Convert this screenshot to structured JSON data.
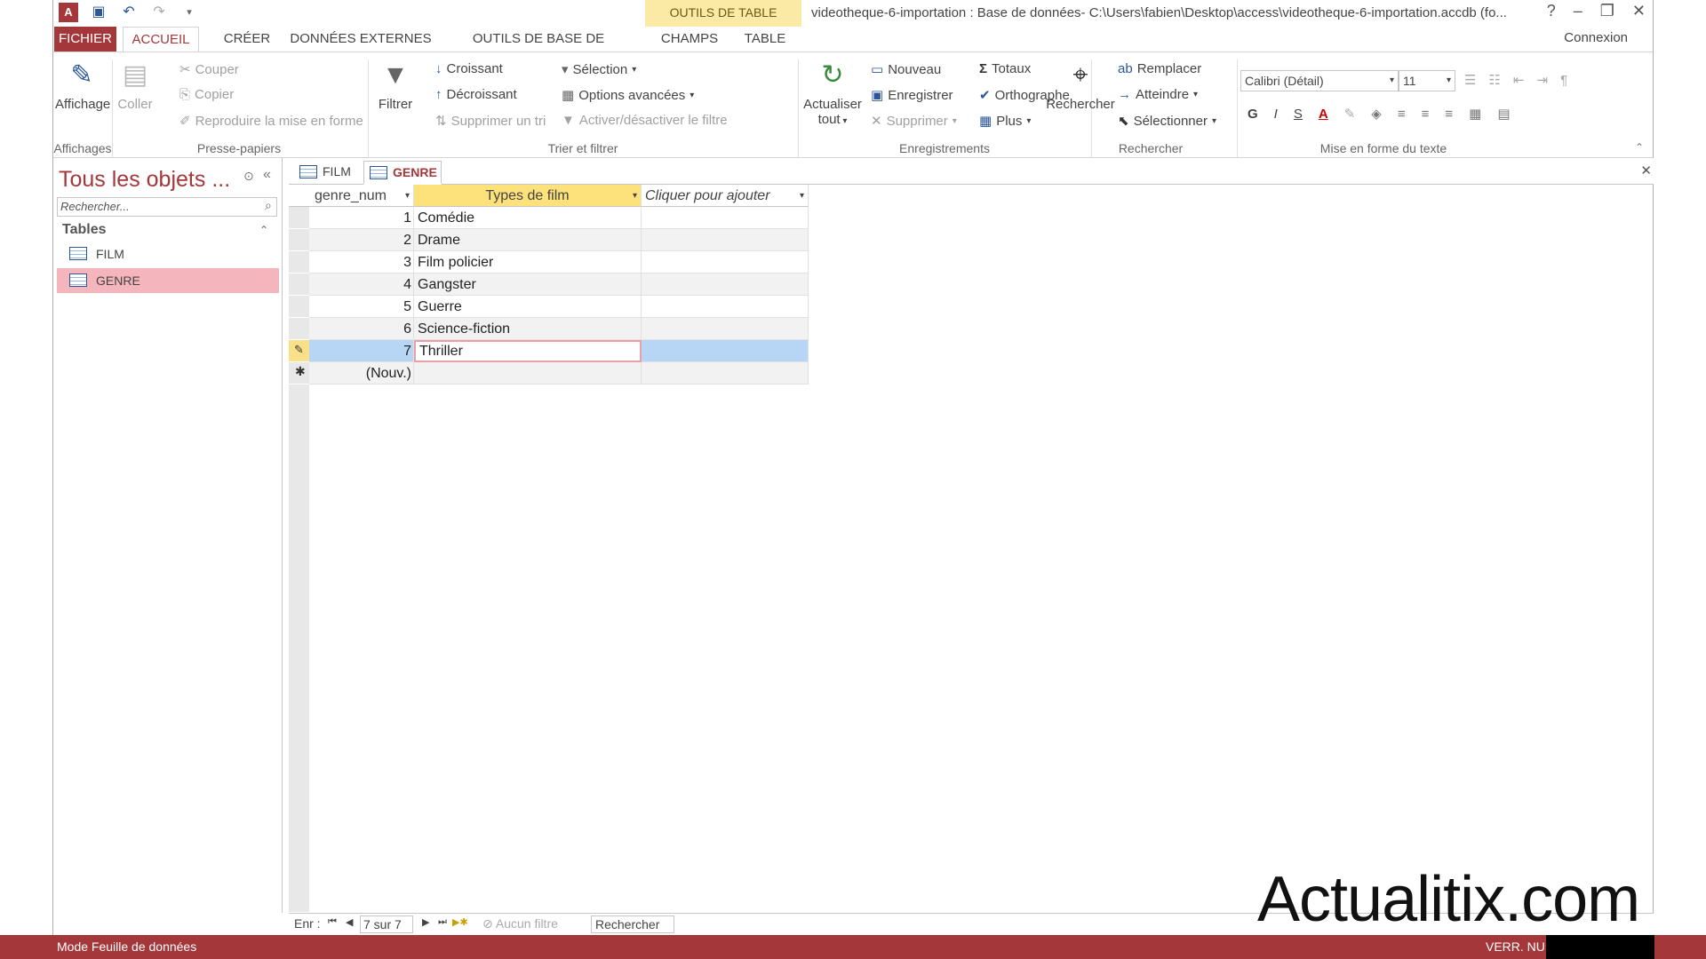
{
  "window": {
    "title": "videotheque-6-importation : Base de données- C:\\Users\\fabien\\Desktop\\access\\videotheque-6-importation.accdb (fo...",
    "contextual_tab_group": "OUTILS DE TABLE",
    "help": "?",
    "minimize": "–",
    "restore": "❐",
    "close": "✕"
  },
  "tabs": {
    "file": "FICHIER",
    "home": "ACCUEIL",
    "create": "CRÉER",
    "external": "DONNÉES EXTERNES",
    "dbtools": "OUTILS DE BASE DE DONNÉES",
    "fields": "CHAMPS",
    "table": "TABLE",
    "signin": "Connexion"
  },
  "ribbon": {
    "views": {
      "label": "Affichage",
      "group": "Affichages"
    },
    "clipboard": {
      "paste": "Coller",
      "cut": "Couper",
      "copy": "Copier",
      "format_painter": "Reproduire la mise en forme",
      "group": "Presse-papiers"
    },
    "sort_filter": {
      "filter": "Filtrer",
      "ascending": "Croissant",
      "descending": "Décroissant",
      "remove_sort": "Supprimer un tri",
      "selection": "Sélection",
      "advanced": "Options avancées",
      "toggle_filter": "Activer/désactiver le filtre",
      "group": "Trier et filtrer"
    },
    "records": {
      "refresh": "Actualiser",
      "refresh2": "tout",
      "new": "Nouveau",
      "save": "Enregistrer",
      "delete": "Supprimer",
      "totals": "Totaux",
      "spelling": "Orthographe",
      "more": "Plus",
      "group": "Enregistrements"
    },
    "find": {
      "find": "Rechercher",
      "replace": "Remplacer",
      "goto": "Atteindre",
      "select": "Sélectionner",
      "group": "Rechercher"
    },
    "text_format": {
      "font": "Calibri (Détail)",
      "size": "11",
      "bold": "G",
      "italic": "I",
      "underline": "S",
      "group": "Mise en forme du texte"
    }
  },
  "nav": {
    "title": "Tous les objets ...",
    "search_placeholder": "Rechercher...",
    "section": "Tables",
    "items": [
      {
        "label": "FILM"
      },
      {
        "label": "GENRE"
      }
    ]
  },
  "doc_tabs": [
    {
      "label": "FILM"
    },
    {
      "label": "GENRE"
    }
  ],
  "datasheet": {
    "columns": [
      "genre_num",
      "Types de film",
      "Cliquer pour ajouter"
    ],
    "rows": [
      {
        "num": "1",
        "type": "Comédie"
      },
      {
        "num": "2",
        "type": "Drame"
      },
      {
        "num": "3",
        "type": "Film policier"
      },
      {
        "num": "4",
        "type": "Gangster"
      },
      {
        "num": "5",
        "type": "Guerre"
      },
      {
        "num": "6",
        "type": "Science-fiction"
      },
      {
        "num": "7",
        "type": "Thriller"
      }
    ],
    "new_row": "(Nouv.)"
  },
  "record_nav": {
    "label": "Enr :",
    "position": "7 sur 7",
    "filter": "Aucun filtre",
    "search": "Rechercher"
  },
  "status": {
    "mode": "Mode Feuille de données",
    "indicators": "VERR. NUM"
  },
  "watermark": "Actualitix.com",
  "colors": {
    "accent": "#a4373a",
    "selected_nav": "#f4b6bc",
    "selected_header": "#fde17a",
    "selected_row": "#b7d6f5"
  }
}
